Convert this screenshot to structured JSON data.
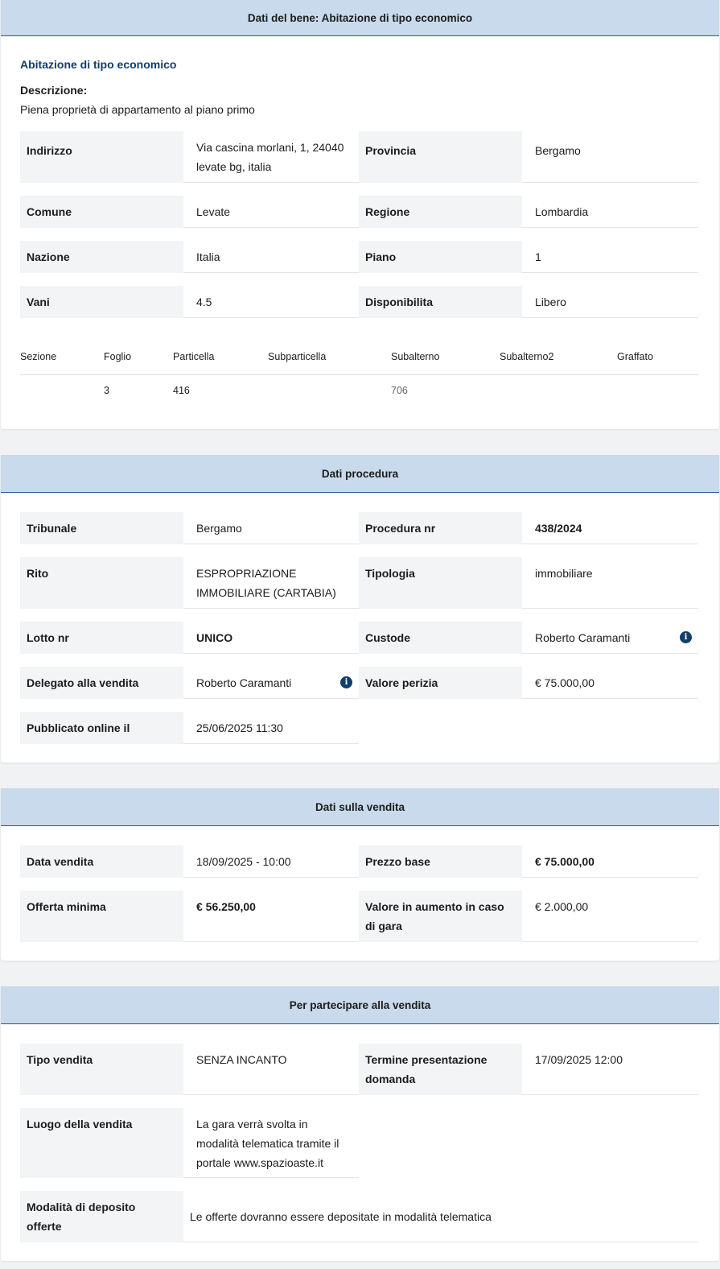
{
  "bene": {
    "header": "Dati del bene: Abitazione di tipo economico",
    "title": "Abitazione di tipo economico",
    "desc_label": "Descrizione:",
    "desc_text": "Piena proprietà di appartamento al piano primo",
    "fields": {
      "indirizzo_label": "Indirizzo",
      "indirizzo_line1": "Via cascina morlani, 1, 24040",
      "indirizzo_line2": "levate bg, italia",
      "provincia_label": "Provincia",
      "provincia_value": "Bergamo",
      "comune_label": "Comune",
      "comune_value": "Levate",
      "regione_label": "Regione",
      "regione_value": "Lombardia",
      "nazione_label": "Nazione",
      "nazione_value": "Italia",
      "piano_label": "Piano",
      "piano_value": "1",
      "vani_label": "Vani",
      "vani_value": "4.5",
      "disponibilita_label": "Disponibilita",
      "disponibilita_value": "Libero"
    },
    "catasto": {
      "headers": [
        "Sezione",
        "Foglio",
        "Particella",
        "Subparticella",
        "Subalterno",
        "Subalterno2",
        "Graffato"
      ],
      "row": [
        "",
        "3",
        "416",
        "",
        "706",
        "",
        ""
      ]
    }
  },
  "procedura": {
    "header": "Dati procedura",
    "tribunale_label": "Tribunale",
    "tribunale_value": "Bergamo",
    "procedura_label": "Procedura nr",
    "procedura_value": "438/2024",
    "rito_label": "Rito",
    "rito_line1": "ESPROPRIAZIONE",
    "rito_line2": "IMMOBILIARE (CARTABIA)",
    "tipologia_label": "Tipologia",
    "tipologia_value": "immobiliare",
    "lotto_label": "Lotto nr",
    "lotto_value": "UNICO",
    "custode_label": "Custode",
    "custode_value": "Roberto Caramanti",
    "delegato_label": "Delegato alla vendita",
    "delegato_value": "Roberto Caramanti",
    "valore_perizia_label": "Valore perizia",
    "valore_perizia_value": "€ 75.000,00",
    "pubblicato_label": "Pubblicato online il",
    "pubblicato_value": "25/06/2025 11:30",
    "info_glyph": "i"
  },
  "vendita": {
    "header": "Dati sulla vendita",
    "data_label": "Data vendita",
    "data_value": "18/09/2025 - 10:00",
    "prezzo_label": "Prezzo base",
    "prezzo_value": "€ 75.000,00",
    "offerta_label": "Offerta minima",
    "offerta_value": "€ 56.250,00",
    "aumento_line1": "Valore in aumento in caso",
    "aumento_line2": "di gara",
    "aumento_value": "€ 2.000,00"
  },
  "partecipare": {
    "header": "Per partecipare alla vendita",
    "tipo_label": "Tipo vendita",
    "tipo_value": "SENZA INCANTO",
    "termine_line1": "Termine presentazione",
    "termine_line2": "domanda",
    "termine_value": "17/09/2025 12:00",
    "luogo_label": "Luogo della vendita",
    "luogo_line1": "La gara verrà svolta in",
    "luogo_line2": "modalità telematica tramite il",
    "luogo_line3": "portale www.spazioaste.it",
    "deposito_line1": "Modalità di deposito",
    "deposito_line2": "offerte",
    "deposito_value": "Le offerte dovranno essere depositate in modalità telematica"
  }
}
